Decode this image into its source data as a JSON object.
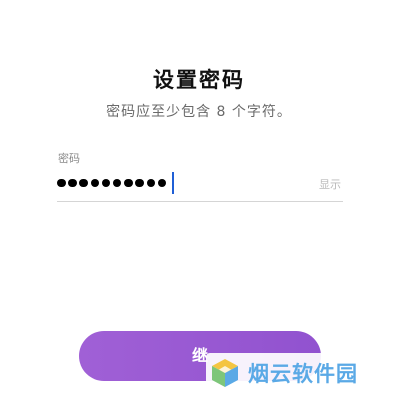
{
  "header": {
    "title": "设置密码",
    "subtitle": "密码应至少包含 8 个字符。"
  },
  "password_field": {
    "label": "密码",
    "masked_value_length": 10,
    "show_toggle_label": "显示"
  },
  "primary_action": {
    "label": "继"
  },
  "watermark": {
    "text": "烟云软件园"
  },
  "colors": {
    "button_gradient_start": "#a060d6",
    "button_gradient_end": "#9152cf",
    "caret": "#1f5fd6",
    "watermark_text": "#5aa9e6"
  }
}
